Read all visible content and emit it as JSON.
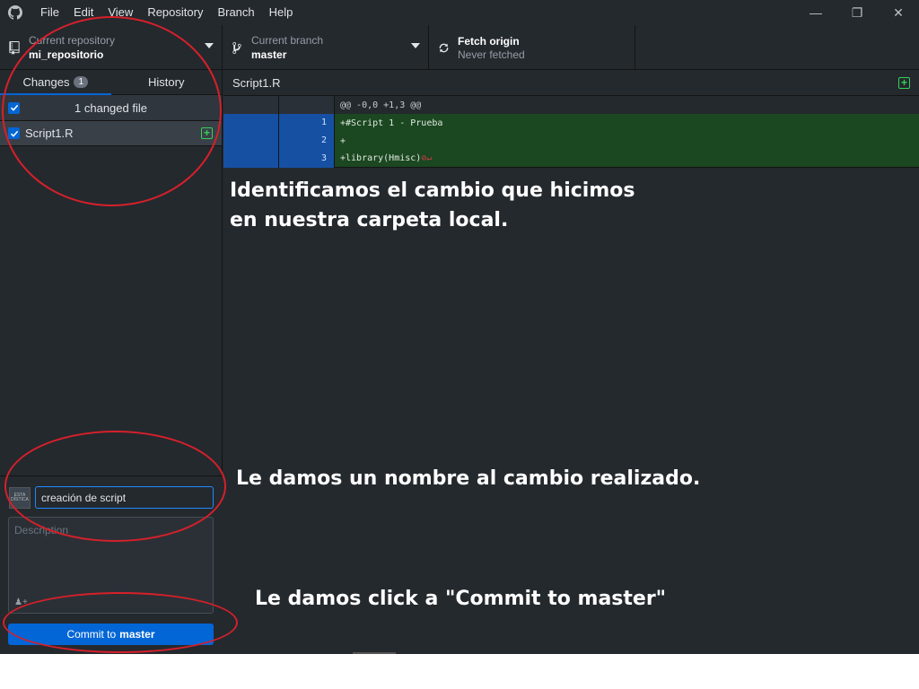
{
  "menu": [
    "File",
    "Edit",
    "View",
    "Repository",
    "Branch",
    "Help"
  ],
  "window_controls": {
    "minimize": "—",
    "restore": "❐",
    "close": "✕"
  },
  "toolbar": {
    "repo_caption": "Current repository",
    "repo_name": "mi_repositorio",
    "branch_caption": "Current branch",
    "branch_name": "master",
    "fetch_title": "Fetch origin",
    "fetch_status": "Never fetched"
  },
  "sidebar": {
    "tabs": [
      {
        "label": "Changes",
        "count": "1"
      },
      {
        "label": "History"
      }
    ],
    "changed_files_label": "1 changed file",
    "files": [
      {
        "name": "Script1.R"
      }
    ]
  },
  "commit": {
    "avatar_text": "ESTA DÍSTICA",
    "summary_value": "creación de script",
    "description_placeholder": "Description",
    "button_prefix": "Commit to",
    "button_branch": "master"
  },
  "diff": {
    "file_name": "Script1.R",
    "hunk_header": "@@ -0,0 +1,3 @@",
    "lines": [
      {
        "num": "1",
        "text": "+#Script 1 - Prueba"
      },
      {
        "num": "2",
        "text": "+"
      },
      {
        "num": "3",
        "text": "+library(Hmisc)"
      }
    ]
  },
  "annotations": {
    "note1_line1": "Identificamos el cambio que hicimos",
    "note1_line2": "en nuestra carpeta local.",
    "note2": "Le damos un nombre al cambio realizado.",
    "note3": "Le damos click a \"Commit to master\""
  },
  "colors": {
    "accent": "#0366d6",
    "annotation_circle": "#d6202a",
    "added_line": "#1b4721"
  }
}
